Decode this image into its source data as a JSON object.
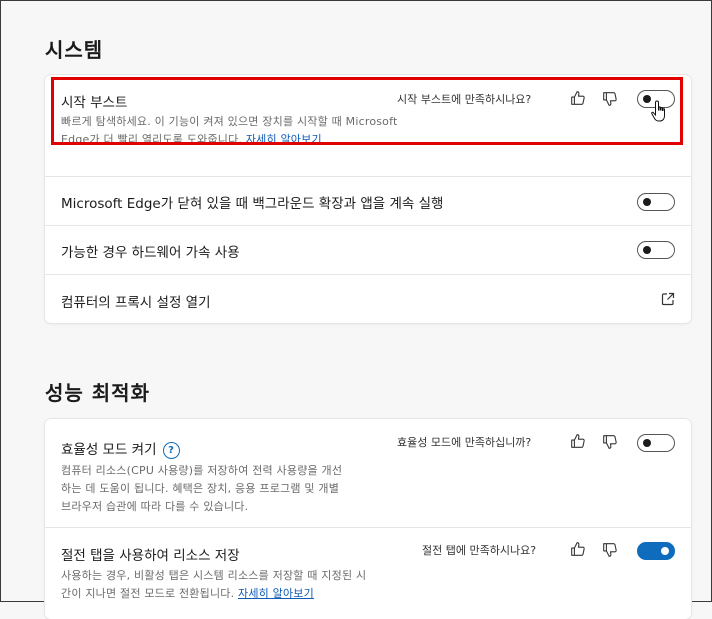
{
  "system": {
    "title": "시스템",
    "startup_boost": {
      "title": "시작 부스트",
      "desc": "빠르게 탐색하세요. 이 기능이 켜져 있으면 장치를 시작할 때 Microsoft Edge가 더 빨리 열리도록 도와줍니다.",
      "link": "자세히 알아보기",
      "feedback": "시작 부스트에 만족하시나요?",
      "enabled": false
    },
    "background_extensions": {
      "title": "Microsoft Edge가 닫혀 있을 때 백그라운드 확장과 앱을 계속 실행",
      "enabled": false
    },
    "hardware_accel": {
      "title": "가능한 경우 하드웨어 가속 사용",
      "enabled": false
    },
    "proxy": {
      "title": "컴퓨터의 프록시 설정 열기",
      "icon": "external-link-icon"
    }
  },
  "performance": {
    "title": "성능 최적화",
    "efficiency_mode": {
      "title": "효율성 모드 켜기",
      "help": "?",
      "desc_line1": "컴퓨터 리소스(CPU 사용량)를 저장하여 전력 사용량을 개선",
      "desc_line2": "하는 데 도움이 됩니다. 혜택은 장치, 응용 프로그램 및 개별",
      "desc_line3": "브라우저 습관에 따라 다를 수 있습니다.",
      "feedback": "효율성 모드에 만족하십니까?",
      "enabled": false
    },
    "sleeping_tabs": {
      "title": "절전 탭을 사용하여 리소스 저장",
      "desc_line1": "사용하는 경우, 비활성 탭은 시스템 리소스를 저장할 때 지정된 시",
      "desc_line2": "간이 지나면 절전 모드로 전환됩니다.",
      "link": "자세히 알아보기",
      "feedback": "절전 탭에 만족하시나요?",
      "enabled": true
    }
  },
  "colors": {
    "accent": "#0f6cbd",
    "highlight": "#e00000"
  }
}
